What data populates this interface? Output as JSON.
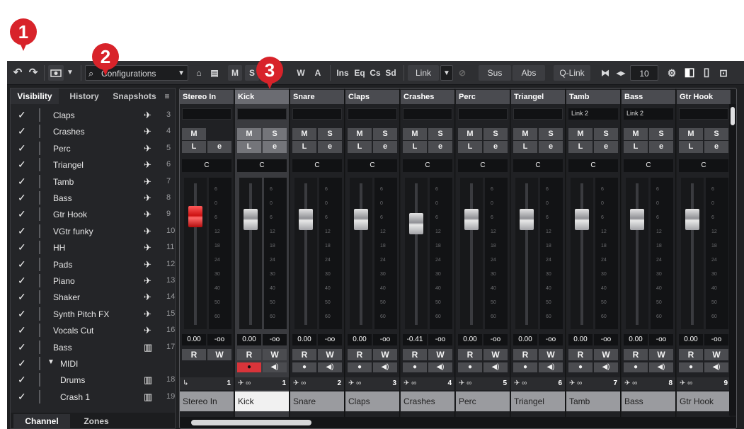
{
  "callouts": [
    "1",
    "2",
    "3"
  ],
  "toolbar": {
    "undo_icon": "undo-icon",
    "redo_icon": "redo-icon",
    "snapshot_icon": "camera-icon",
    "dropdown_glyph": "▼",
    "search_icon": "search-icon",
    "configurations_label": "Configurations",
    "m_label": "M",
    "s_label": "S",
    "w_label": "W",
    "a_label": "A",
    "ins_label": "Ins",
    "eq_label": "Eq",
    "cs_label": "Cs",
    "sd_label": "Sd",
    "link_label": "Link",
    "sus_label": "Sus",
    "abs_label": "Abs",
    "qlink_label": "Q-Link",
    "channel_count": "10"
  },
  "left_zone": {
    "tabs": [
      "Visibility",
      "History",
      "Snapshots"
    ],
    "menu_glyph": "≡",
    "rows": [
      {
        "name": "Claps",
        "num": "3"
      },
      {
        "name": "Crashes",
        "num": "4"
      },
      {
        "name": "Perc",
        "num": "5"
      },
      {
        "name": "Triangel",
        "num": "6"
      },
      {
        "name": "Tamb",
        "num": "7"
      },
      {
        "name": "Bass",
        "num": "8"
      },
      {
        "name": "Gtr Hook",
        "num": "9"
      },
      {
        "name": "VGtr funky",
        "num": "10"
      },
      {
        "name": "HH",
        "num": "11"
      },
      {
        "name": "Pads",
        "num": "12"
      },
      {
        "name": "Piano",
        "num": "13"
      },
      {
        "name": "Shaker",
        "num": "14"
      },
      {
        "name": "Synth Pitch FX",
        "num": "15"
      },
      {
        "name": "Vocals Cut",
        "num": "16"
      },
      {
        "name": "Bass",
        "num": "17"
      },
      {
        "name": "MIDI",
        "num": ""
      },
      {
        "name": "Drums",
        "num": "18"
      },
      {
        "name": "Crash 1",
        "num": "19"
      }
    ],
    "bottom_tabs": [
      "Channel",
      "Zones"
    ]
  },
  "mixer": {
    "strips": [
      {
        "name": "Stereo In",
        "link": "",
        "val1": "0.00",
        "val2": "-oo",
        "num": "1",
        "bottom": "Stereo In"
      },
      {
        "name": "Kick",
        "link": "",
        "val1": "0.00",
        "val2": "-oo",
        "num": "1",
        "bottom": "Kick"
      },
      {
        "name": "Snare",
        "link": "",
        "val1": "0.00",
        "val2": "-oo",
        "num": "2",
        "bottom": "Snare"
      },
      {
        "name": "Claps",
        "link": "",
        "val1": "0.00",
        "val2": "-oo",
        "num": "3",
        "bottom": "Claps"
      },
      {
        "name": "Crashes",
        "link": "",
        "val1": "-0.41",
        "val2": "-oo",
        "num": "4",
        "bottom": "Crashes"
      },
      {
        "name": "Perc",
        "link": "",
        "val1": "0.00",
        "val2": "-oo",
        "num": "5",
        "bottom": "Perc"
      },
      {
        "name": "Triangel",
        "link": "",
        "val1": "0.00",
        "val2": "-oo",
        "num": "6",
        "bottom": "Triangel"
      },
      {
        "name": "Tamb",
        "link": "Link 2",
        "val1": "0.00",
        "val2": "-oo",
        "num": "7",
        "bottom": "Tamb"
      },
      {
        "name": "Bass",
        "link": "Link 2",
        "val1": "0.00",
        "val2": "-oo",
        "num": "8",
        "bottom": "Bass"
      },
      {
        "name": "Gtr Hook",
        "link": "",
        "val1": "0.00",
        "val2": "-oo",
        "num": "9",
        "bottom": "Gtr Hook"
      }
    ],
    "labels": {
      "m": "M",
      "s": "S",
      "l": "L",
      "e": "e",
      "r": "R",
      "w": "W",
      "c": "C"
    },
    "meter_ticks": [
      "6",
      "0",
      "6",
      "12",
      "18",
      "24",
      "30",
      "40",
      "50",
      "60"
    ],
    "colors": {
      "accent_red": "#d8343a",
      "selected_strip": "#3a3b3f"
    }
  }
}
